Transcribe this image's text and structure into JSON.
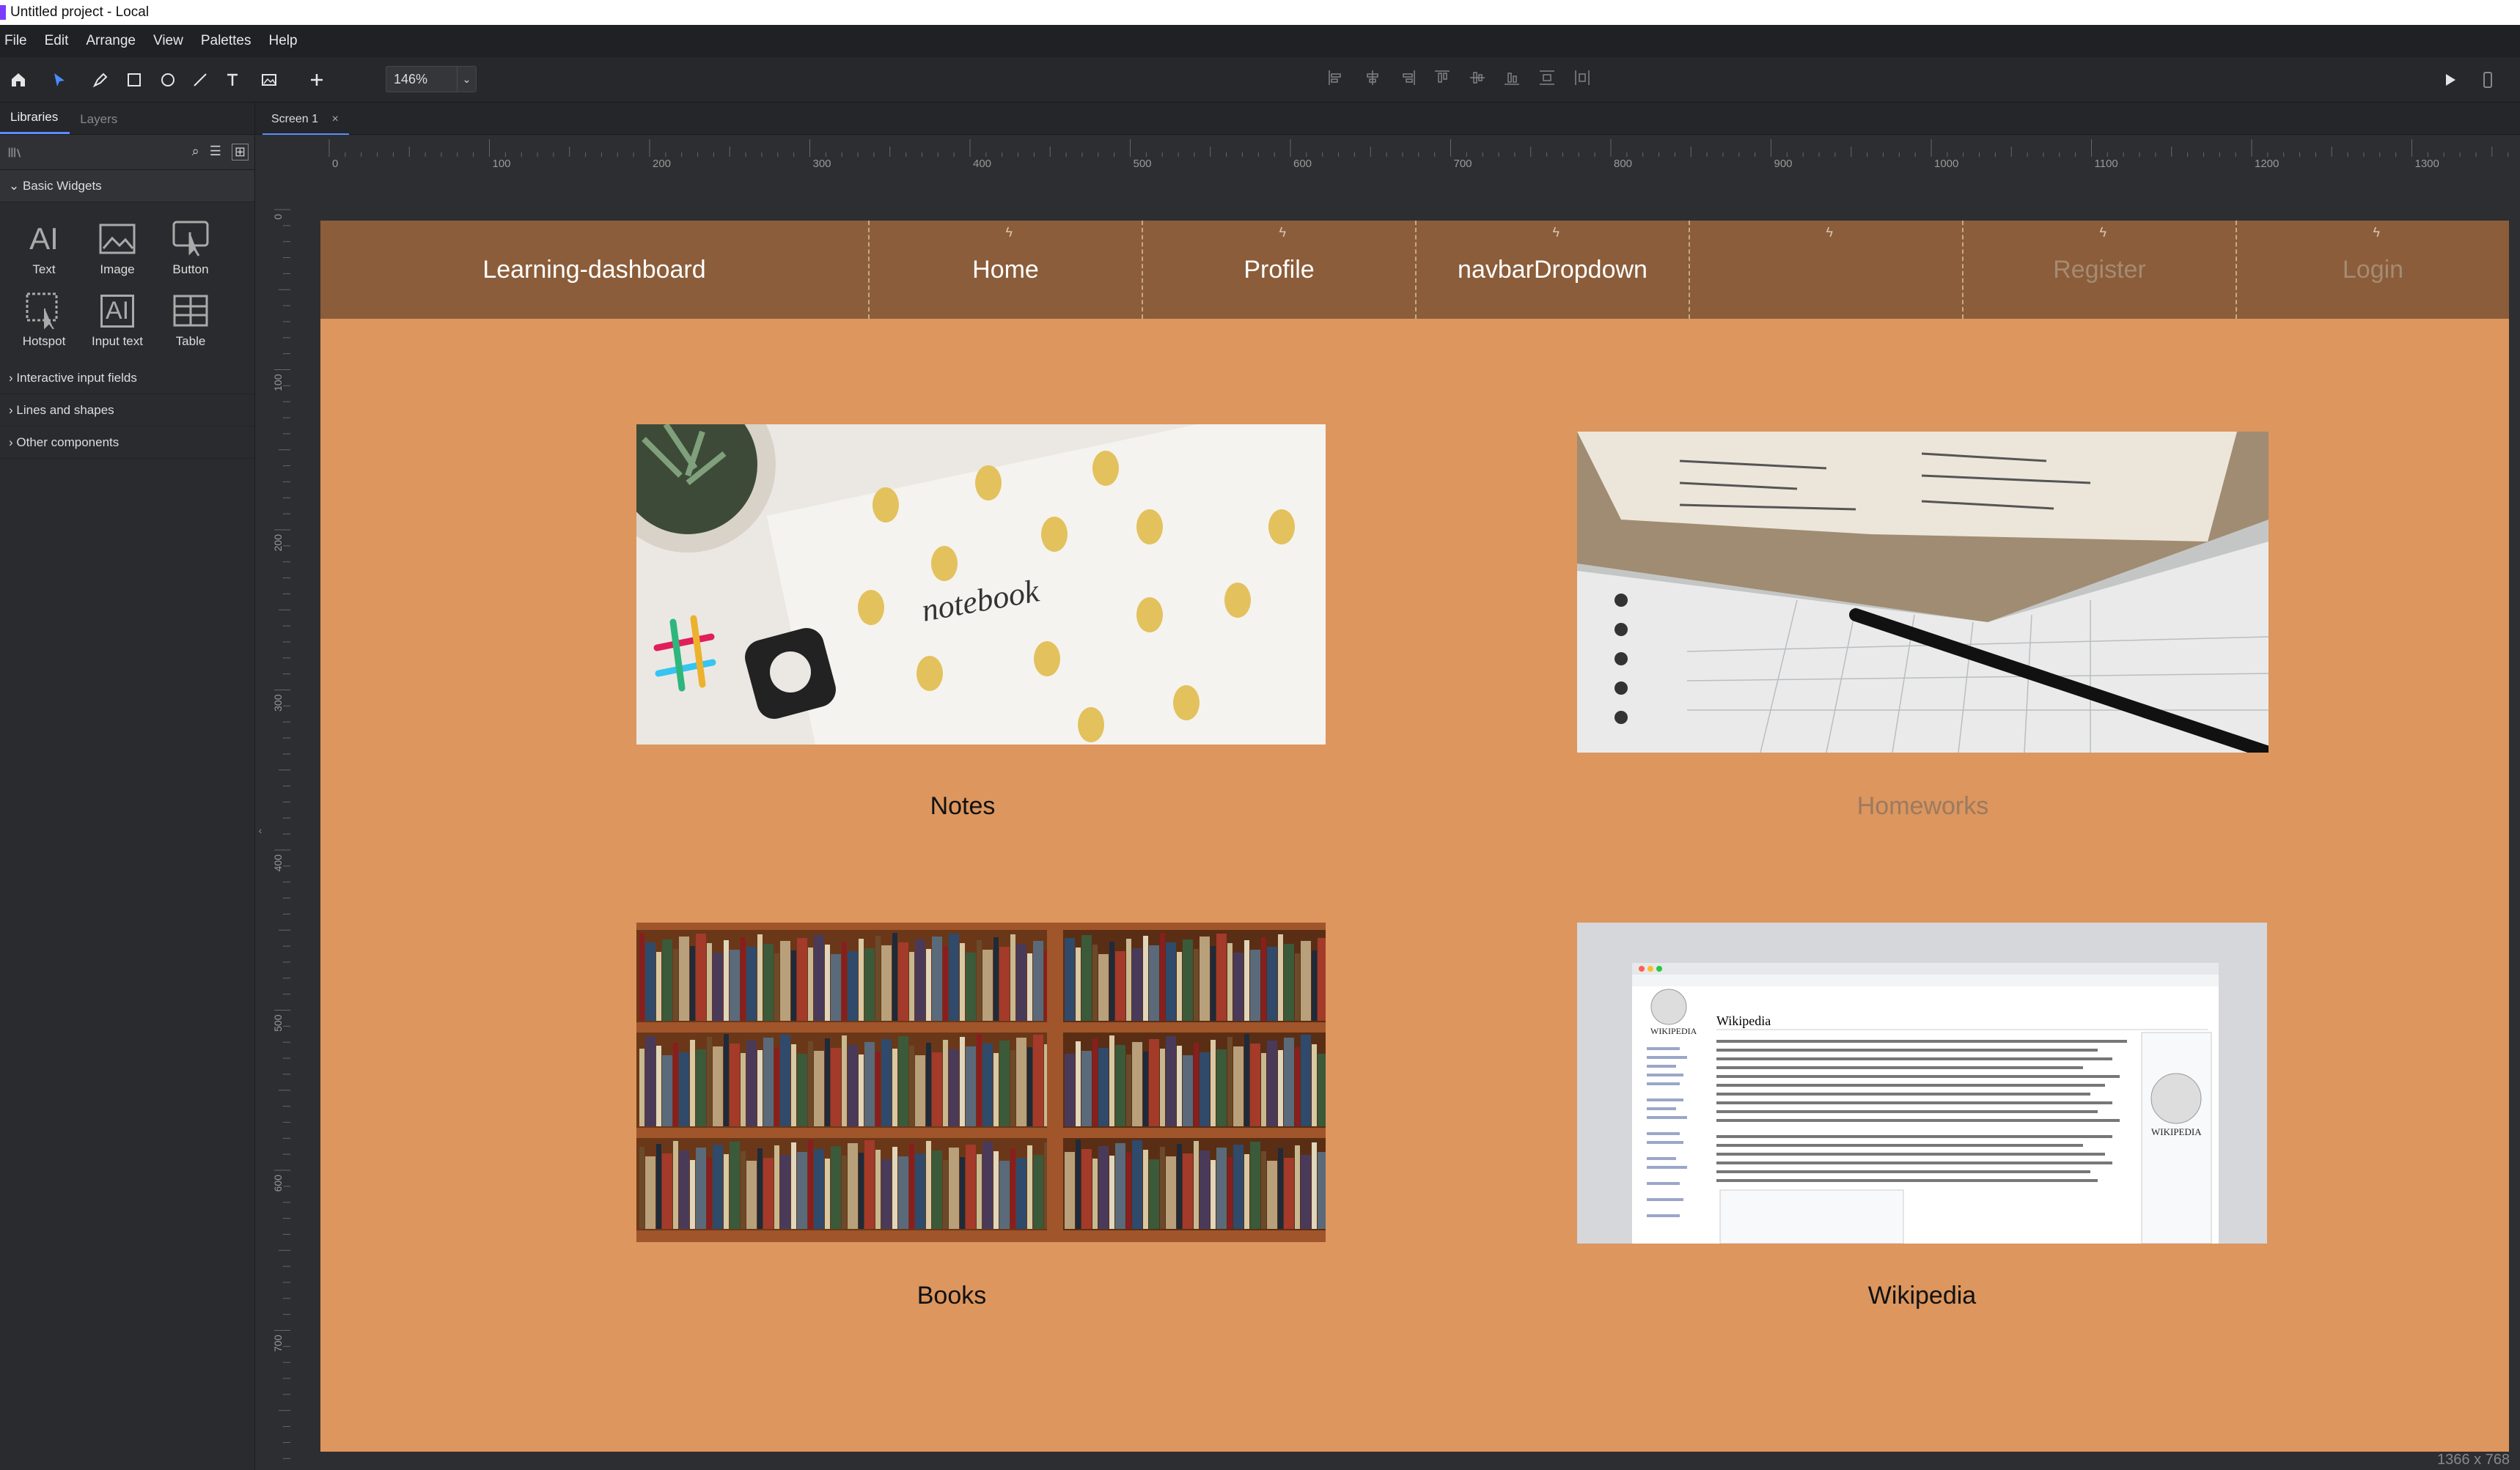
{
  "window": {
    "title": "Untitled project - Local"
  },
  "menu": [
    "File",
    "Edit",
    "Arrange",
    "View",
    "Palettes",
    "Help"
  ],
  "toolbar": {
    "zoom": "146%"
  },
  "sidebar": {
    "tabs": [
      "Libraries",
      "Layers"
    ],
    "section_title": "Basic Widgets",
    "widgets": [
      "Text",
      "Image",
      "Button",
      "Hotspot",
      "Input text",
      "Table"
    ],
    "groups": [
      "Interactive input fields",
      "Lines and shapes",
      "Other components"
    ]
  },
  "canvas_tab": "Screen 1",
  "ruler": {
    "h_ticks": [
      "0",
      "100",
      "200",
      "300",
      "400",
      "500",
      "600",
      "700",
      "800",
      "900",
      "1000",
      "1100",
      "1200",
      "1300"
    ],
    "v_ticks": [
      "0",
      "100",
      "200",
      "300",
      "400",
      "500",
      "600",
      "700"
    ]
  },
  "screen": {
    "navbar": {
      "brand": "Learning-dashboard",
      "items": [
        "Home",
        "Profile",
        "navbarDropdown",
        "",
        "Register",
        "Login"
      ]
    },
    "cards": [
      {
        "label": "Notes"
      },
      {
        "label": "Homeworks"
      },
      {
        "label": "Books"
      },
      {
        "label": "Wikipedia"
      }
    ]
  },
  "status": {
    "size": "1366 x 768"
  },
  "colors": {
    "navbar": "#8b5d3a",
    "page": "#dc965e",
    "accent": "#5a8cff"
  }
}
